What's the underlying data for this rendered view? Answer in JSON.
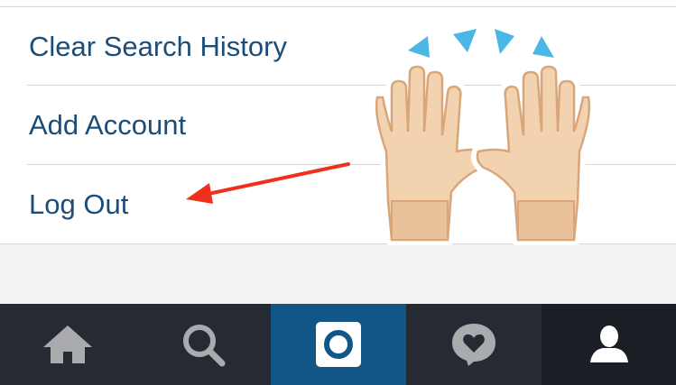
{
  "menu": {
    "items": [
      {
        "label": "Clear Search History"
      },
      {
        "label": "Add Account"
      },
      {
        "label": "Log Out"
      }
    ]
  },
  "annotation": {
    "arrow_color": "#f0301c",
    "emoji": "raising-hands-emoji"
  },
  "tabbar": {
    "tabs": [
      {
        "icon": "home-icon"
      },
      {
        "icon": "search-icon"
      },
      {
        "icon": "camera-icon",
        "active": true
      },
      {
        "icon": "activity-heart-icon"
      },
      {
        "icon": "profile-icon"
      }
    ],
    "colors": {
      "background": "#262a33",
      "active": "#125688",
      "profile_bg": "#1b1e25",
      "icon": "#a9abaf"
    }
  },
  "colors": {
    "link_text": "#1c4d78",
    "separator": "#d6d6d6",
    "page_bg": "#f2f2f2"
  }
}
